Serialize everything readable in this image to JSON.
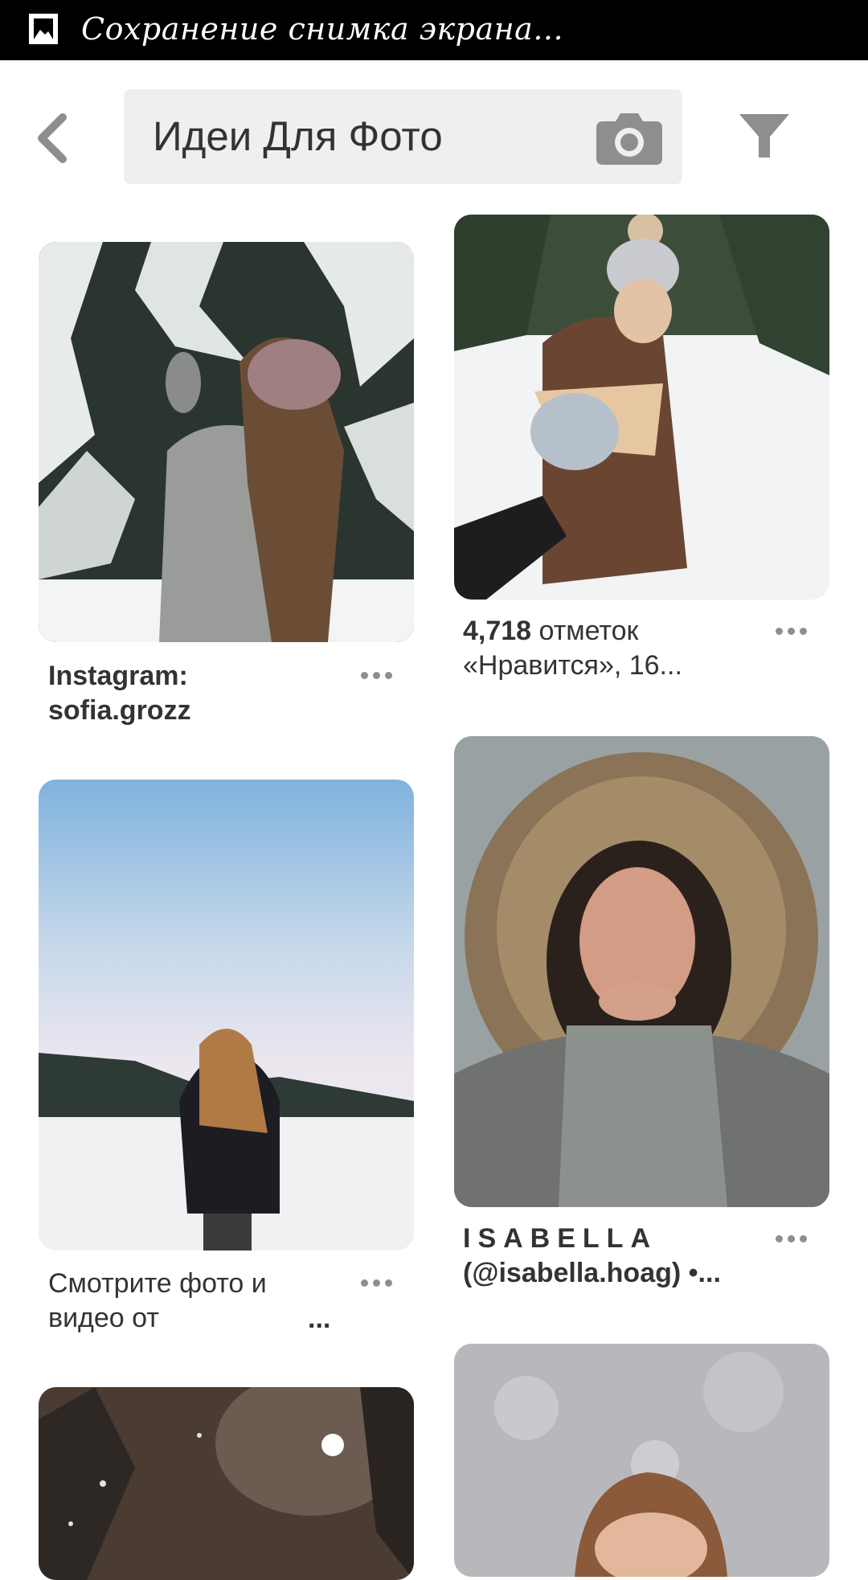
{
  "status_bar": {
    "text": "Сохранение снимка экрана...",
    "icon": "image-icon",
    "background": "#000000"
  },
  "header": {
    "back_icon": "chevron-left-icon",
    "search": {
      "value": "Идеи Для Фото",
      "camera_icon": "camera-icon"
    },
    "filter_icon": "filter-icon"
  },
  "pins": [
    {
      "column": "left",
      "title": "Instagram: sofia.grozz",
      "title_bold": true,
      "more_icon": "more-dots-icon"
    },
    {
      "column": "right",
      "likes": "4,718",
      "title_rest": " отметок «Нравится», 16...",
      "more_icon": "more-dots-icon"
    },
    {
      "column": "left",
      "title_line1": "Смотрите фото и",
      "title_line2": "видео от",
      "title_ellipsis": "...",
      "more_icon": "more-dots-icon"
    },
    {
      "column": "right",
      "title_line1": "ISABELLA",
      "title_line2": "(@isabella.hoag) •...",
      "title_bold": true,
      "more_icon": "more-dots-icon"
    },
    {
      "column": "left",
      "title": ""
    },
    {
      "column": "right",
      "title": ""
    }
  ],
  "colors": {
    "search_bg": "#efefef",
    "icon_gray": "#8e8e8e",
    "text": "#333333"
  }
}
